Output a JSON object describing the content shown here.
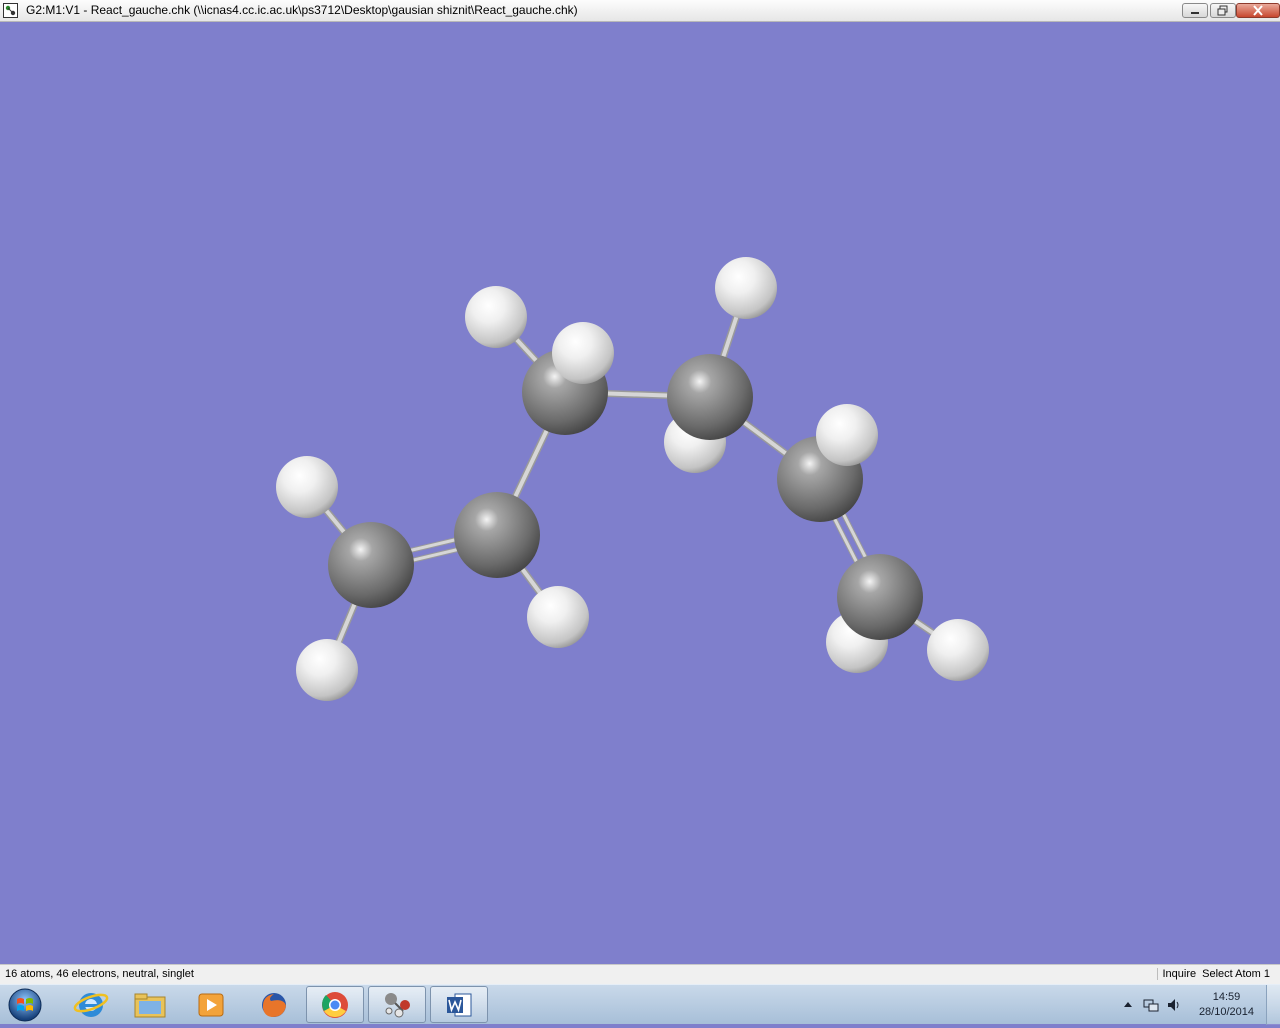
{
  "window": {
    "title": "G2:M1:V1 - React_gauche.chk (\\\\icnas4.cc.ic.ac.uk\\ps3712\\Desktop\\gausian shiznit\\React_gauche.chk)"
  },
  "viewport": {
    "background_color": "#7f7fcc"
  },
  "molecule": {
    "carbon_color": "#8a8a8a",
    "hydrogen_color": "#e8e8e8",
    "bond_color": "#d6d6d6",
    "atoms": [
      {
        "id": "C1",
        "element": "C"
      },
      {
        "id": "C2",
        "element": "C"
      },
      {
        "id": "C3",
        "element": "C"
      },
      {
        "id": "C4",
        "element": "C"
      },
      {
        "id": "C5",
        "element": "C"
      },
      {
        "id": "C6",
        "element": "C"
      },
      {
        "id": "H1",
        "element": "H"
      },
      {
        "id": "H2",
        "element": "H"
      },
      {
        "id": "H3",
        "element": "H"
      },
      {
        "id": "H4",
        "element": "H"
      },
      {
        "id": "H5",
        "element": "H"
      },
      {
        "id": "H6",
        "element": "H"
      },
      {
        "id": "H7",
        "element": "H"
      },
      {
        "id": "H8",
        "element": "H"
      },
      {
        "id": "H9",
        "element": "H"
      },
      {
        "id": "H10",
        "element": "H"
      }
    ],
    "bonds": [
      {
        "from": "C1",
        "to": "C2",
        "order": 2
      },
      {
        "from": "C2",
        "to": "C3",
        "order": 1
      },
      {
        "from": "C3",
        "to": "C4",
        "order": 1
      },
      {
        "from": "C4",
        "to": "C5",
        "order": 1
      },
      {
        "from": "C5",
        "to": "C6",
        "order": 2
      },
      {
        "from": "C1",
        "to": "H1",
        "order": 1
      },
      {
        "from": "C1",
        "to": "H2",
        "order": 1
      },
      {
        "from": "C2",
        "to": "H3",
        "order": 1
      },
      {
        "from": "C3",
        "to": "H4",
        "order": 1
      },
      {
        "from": "C3",
        "to": "H5",
        "order": 1
      },
      {
        "from": "C4",
        "to": "H6",
        "order": 1
      },
      {
        "from": "C4",
        "to": "H7",
        "order": 1
      },
      {
        "from": "C5",
        "to": "H8",
        "order": 1
      },
      {
        "from": "C6",
        "to": "H9",
        "order": 1
      },
      {
        "from": "C6",
        "to": "H10",
        "order": 1
      }
    ]
  },
  "statusbar": {
    "info": "16 atoms, 46 electrons, neutral, singlet",
    "mode": "Inquire",
    "selection": "Select Atom 1"
  },
  "taskbar": {
    "items": [
      {
        "name": "internet-explorer-icon",
        "active": false
      },
      {
        "name": "file-explorer-icon",
        "active": false
      },
      {
        "name": "media-player-icon",
        "active": false
      },
      {
        "name": "firefox-icon",
        "active": false
      },
      {
        "name": "chrome-icon",
        "active": true
      },
      {
        "name": "gaussview-icon",
        "active": true
      },
      {
        "name": "word-icon",
        "active": true
      }
    ],
    "clock": {
      "time": "14:59",
      "date": "28/10/2014"
    }
  }
}
